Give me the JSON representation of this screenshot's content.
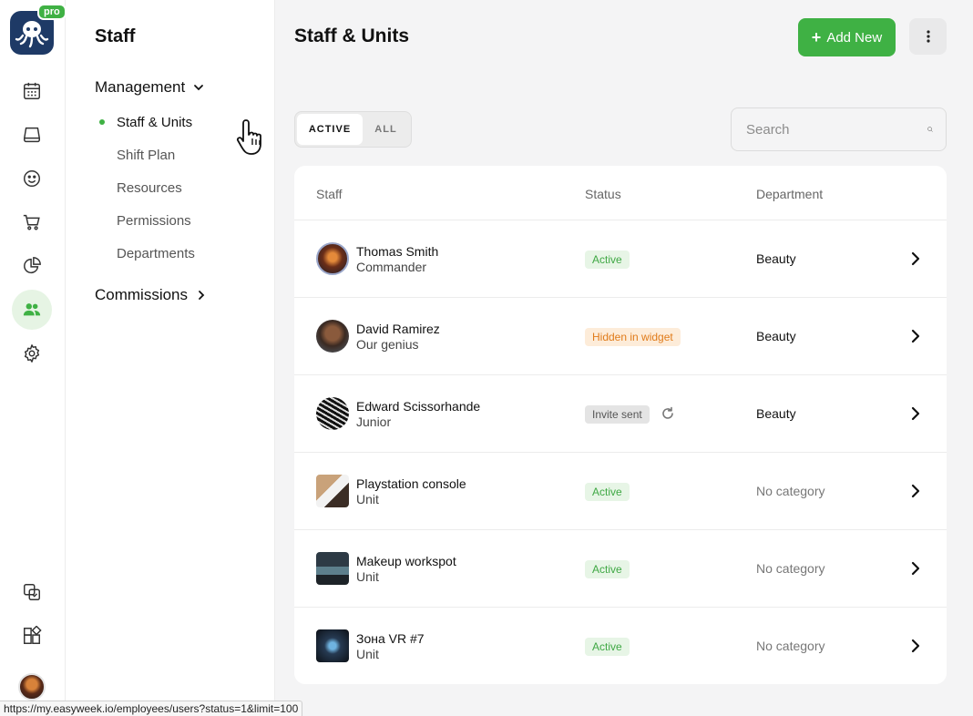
{
  "sidebar": {
    "pro_badge": "pro",
    "title": "Staff",
    "management_label": "Management",
    "items": [
      {
        "label": "Staff & Units",
        "active": true
      },
      {
        "label": "Shift Plan",
        "active": false
      },
      {
        "label": "Resources",
        "active": false
      },
      {
        "label": "Permissions",
        "active": false
      },
      {
        "label": "Departments",
        "active": false
      }
    ],
    "commissions_label": "Commissions"
  },
  "rail": {
    "icons": [
      "calendar-icon",
      "inbox-icon",
      "smiley-icon",
      "cart-icon",
      "pie-chart-icon",
      "people-icon",
      "gear-icon",
      "copy-icon",
      "widgets-icon"
    ],
    "active": "people-icon"
  },
  "header": {
    "title": "Staff & Units",
    "add_label": "Add New"
  },
  "filters": {
    "active_label": "ACTIVE",
    "all_label": "ALL",
    "search_placeholder": "Search"
  },
  "table": {
    "columns": {
      "staff": "Staff",
      "status": "Status",
      "department": "Department"
    },
    "rows": [
      {
        "name": "Thomas Smith",
        "role": "Commander",
        "status": "Active",
        "status_type": "active",
        "department": "Beauty",
        "kind": "person"
      },
      {
        "name": "David Ramirez",
        "role": "Our genius",
        "status": "Hidden in widget",
        "status_type": "hidden",
        "department": "Beauty",
        "kind": "person"
      },
      {
        "name": "Edward Scissorhande",
        "role": "Junior",
        "status": "Invite sent",
        "status_type": "invite",
        "department": "Beauty",
        "kind": "person"
      },
      {
        "name": "Playstation console",
        "role": "Unit",
        "status": "Active",
        "status_type": "active",
        "department": "No category",
        "kind": "unit"
      },
      {
        "name": "Makeup workspot",
        "role": "Unit",
        "status": "Active",
        "status_type": "active",
        "department": "No category",
        "kind": "unit"
      },
      {
        "name": "Зона VR #7",
        "role": "Unit",
        "status": "Active",
        "status_type": "active",
        "department": "No category",
        "kind": "unit"
      }
    ]
  },
  "colors": {
    "accent": "#3fb144",
    "hidden": "#e07b1a"
  },
  "status_bar": {
    "url": "https://my.easyweek.io/employees/users?status=1&limit=100"
  }
}
